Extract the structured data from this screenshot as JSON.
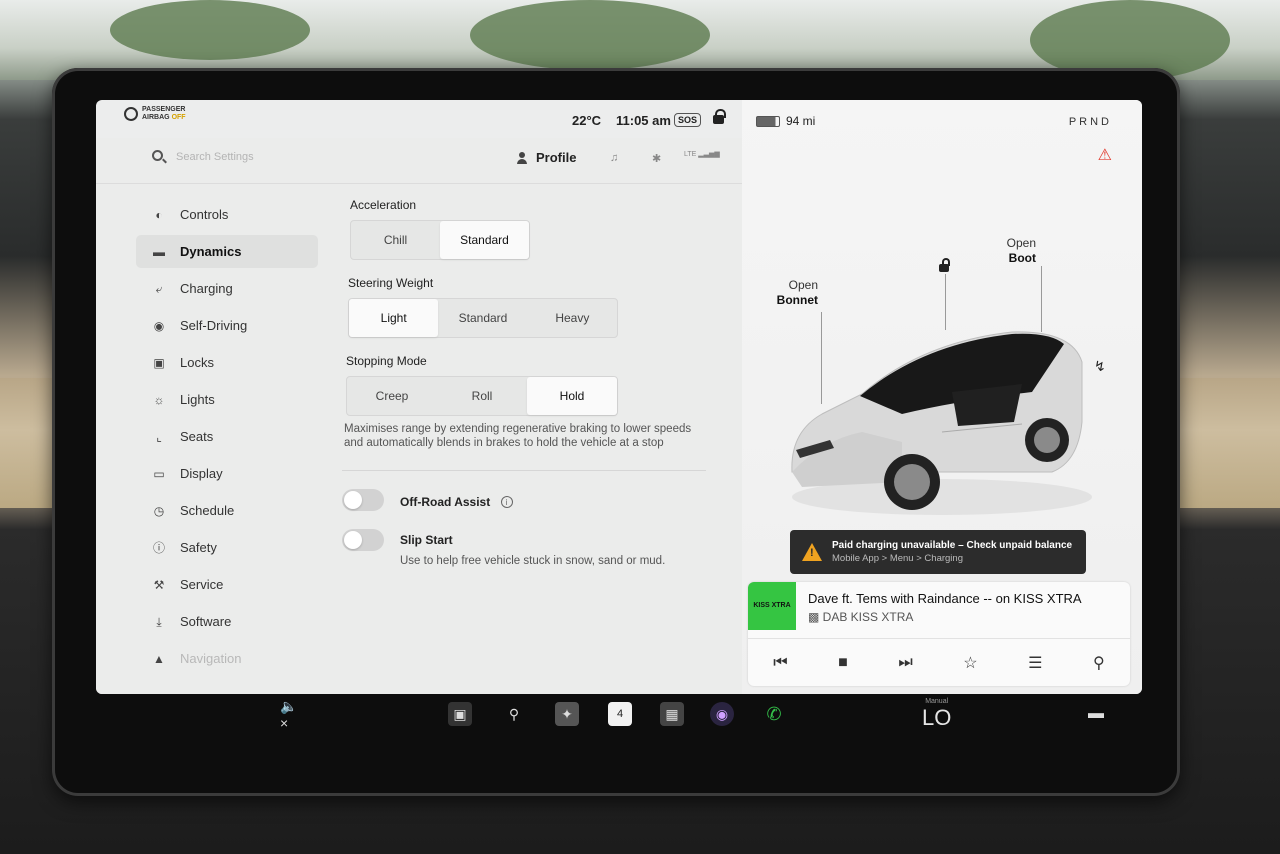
{
  "status": {
    "airbag_line1": "PASSENGER",
    "airbag_line2": "AIRBAG",
    "airbag_state": "OFF",
    "temperature": "22°C",
    "time": "11:05 am",
    "sos": "SOS"
  },
  "header": {
    "search_placeholder": "Search Settings",
    "profile_label": "Profile",
    "lte": "LTE"
  },
  "nav": {
    "items": [
      {
        "label": "Controls",
        "icon": "toggle-icon"
      },
      {
        "label": "Dynamics",
        "icon": "car-icon"
      },
      {
        "label": "Charging",
        "icon": "bolt-icon"
      },
      {
        "label": "Self-Driving",
        "icon": "steering-wheel-icon"
      },
      {
        "label": "Locks",
        "icon": "lock-icon"
      },
      {
        "label": "Lights",
        "icon": "sun-icon"
      },
      {
        "label": "Seats",
        "icon": "seat-icon"
      },
      {
        "label": "Display",
        "icon": "display-icon"
      },
      {
        "label": "Schedule",
        "icon": "alarm-icon"
      },
      {
        "label": "Safety",
        "icon": "alert-icon"
      },
      {
        "label": "Service",
        "icon": "wrench-icon"
      },
      {
        "label": "Software",
        "icon": "download-icon"
      },
      {
        "label": "Navigation",
        "icon": "navigation-icon"
      }
    ],
    "active_index": 1
  },
  "dynamics": {
    "acceleration": {
      "label": "Acceleration",
      "options": [
        "Chill",
        "Standard"
      ],
      "selected": "Standard"
    },
    "steering": {
      "label": "Steering Weight",
      "options": [
        "Light",
        "Standard",
        "Heavy"
      ],
      "selected": "Light"
    },
    "stopping": {
      "label": "Stopping Mode",
      "options": [
        "Creep",
        "Roll",
        "Hold"
      ],
      "selected": "Hold"
    },
    "stopping_desc": "Maximises range by extending regenerative braking to lower speeds and automatically blends in brakes to hold the vehicle at a stop",
    "offroad": {
      "label": "Off-Road Assist",
      "on": false
    },
    "slipstart": {
      "label": "Slip Start",
      "desc": "Use to help free vehicle stuck in snow, sand or mud.",
      "on": false
    }
  },
  "car": {
    "range": "94 mi",
    "gear": "PRND",
    "bonnet_line1": "Open",
    "bonnet_line2": "Bonnet",
    "boot_line1": "Open",
    "boot_line2": "Boot",
    "alert_title": "Paid charging unavailable – Check unpaid balance",
    "alert_sub": "Mobile App > Menu > Charging"
  },
  "media": {
    "logo_text": "KISS XTRA",
    "track": "Dave ft. Tems with Raindance -- on KISS XTRA",
    "station": "DAB KISS XTRA"
  },
  "dock": {
    "calendar_day": "4",
    "climate_mode": "Manual",
    "climate_value": "LO"
  },
  "colors": {
    "accent_green": "#35c542",
    "alert_orange": "#f0a320",
    "seatbelt_red": "#e23b2e"
  }
}
